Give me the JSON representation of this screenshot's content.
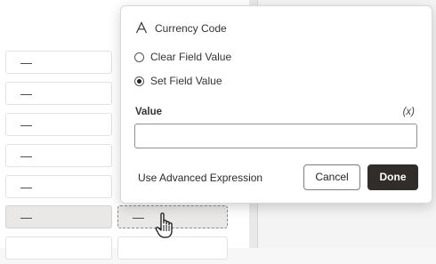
{
  "grid": {
    "rows": [
      {
        "c1": "—",
        "c2": ""
      },
      {
        "c1": "—",
        "c2": ""
      },
      {
        "c1": "—",
        "c2": ""
      },
      {
        "c1": "—",
        "c2": ""
      },
      {
        "c1": "—",
        "c2": ""
      },
      {
        "c1": "—",
        "c2": "—"
      },
      {
        "c1": "",
        "c2": ""
      }
    ],
    "selected_row_index": 5
  },
  "popover": {
    "field_type_icon": "text-type-icon",
    "field_name": "Currency Code",
    "options": [
      {
        "label": "Clear Field Value",
        "checked": false
      },
      {
        "label": "Set Field Value",
        "checked": true
      }
    ],
    "value_label": "Value",
    "variable_hint": "(x)",
    "value_input": {
      "value": "",
      "placeholder": ""
    },
    "advanced_link": "Use Advanced Expression",
    "cancel_label": "Cancel",
    "done_label": "Done"
  },
  "cursor_icon": "hand-pointer-icon"
}
